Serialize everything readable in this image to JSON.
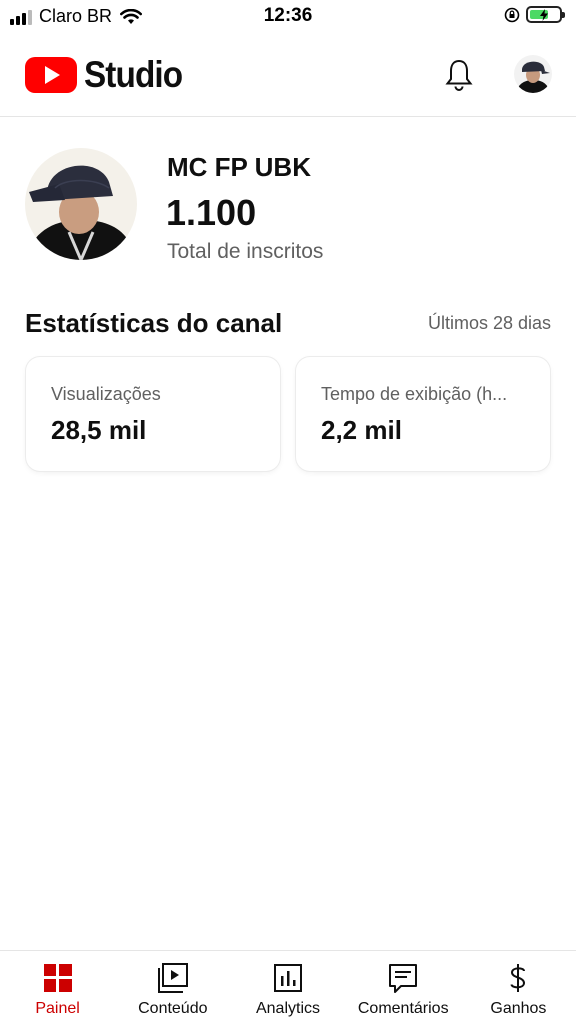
{
  "status_bar": {
    "carrier": "Claro BR",
    "time": "12:36"
  },
  "header": {
    "logo_text": "Studio",
    "notification_icon": "bell-icon",
    "account_icon": "avatar"
  },
  "channel": {
    "name": "MC FP UBK",
    "subscriber_count": "1.100",
    "subscriber_label": "Total de inscritos"
  },
  "stats": {
    "title": "Estatísticas do canal",
    "period": "Últimos 28 dias",
    "cards": [
      {
        "label": "Visualizações",
        "value": "28,5 mil"
      },
      {
        "label": "Tempo de exibição (h...",
        "value": "2,2 mil"
      }
    ]
  },
  "bottom_nav": {
    "items": [
      {
        "label": "Painel",
        "icon": "dashboard-icon",
        "active": true
      },
      {
        "label": "Conteúdo",
        "icon": "content-icon",
        "active": false
      },
      {
        "label": "Analytics",
        "icon": "analytics-icon",
        "active": false
      },
      {
        "label": "Comentários",
        "icon": "comments-icon",
        "active": false
      },
      {
        "label": "Ganhos",
        "icon": "dollar-icon",
        "active": false
      }
    ]
  },
  "colors": {
    "brand_red": "#ff0000",
    "active_red": "#cc0000",
    "battery_green": "#4cd964"
  }
}
